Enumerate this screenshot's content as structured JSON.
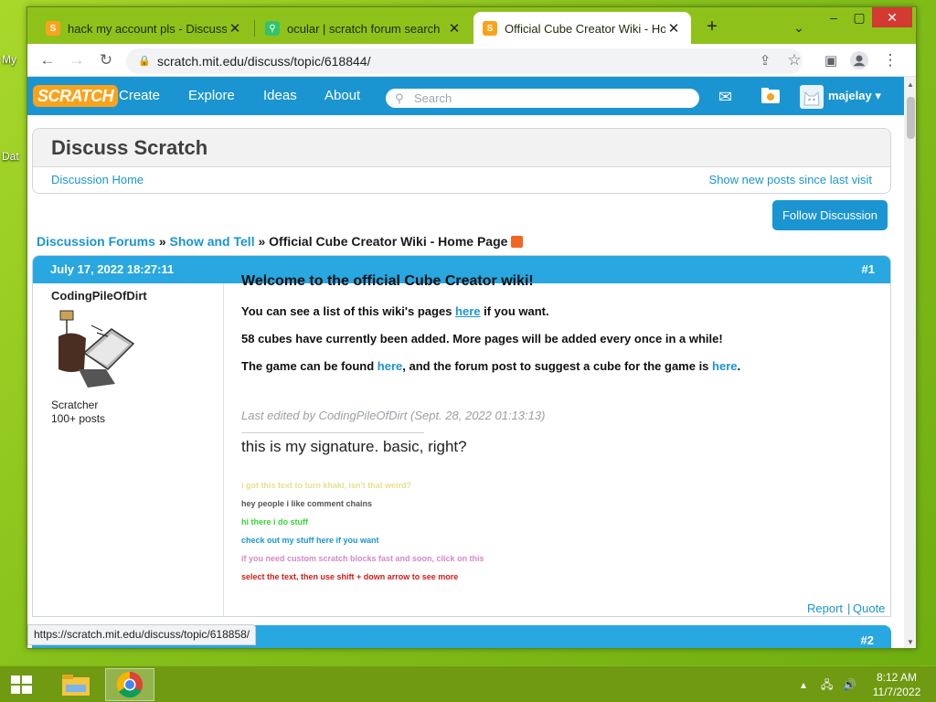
{
  "desktop": {
    "fragments": [
      "My",
      "Dat"
    ]
  },
  "browser": {
    "tabs": [
      {
        "title": "hack my account pls - Discuss Sc",
        "favicon": "scratch-favicon",
        "active": false
      },
      {
        "title": "ocular | scratch forum search",
        "favicon": "ocular-favicon",
        "active": false
      },
      {
        "title": "Official Cube Creator Wiki - Hom",
        "favicon": "scratch-favicon",
        "active": true
      }
    ],
    "new_tab": "+",
    "url": "scratch.mit.edu/discuss/topic/618844/",
    "status_url": "https://scratch.mit.edu/discuss/topic/618858/"
  },
  "scratch_nav": {
    "logo": "SCRATCH",
    "links": [
      "Create",
      "Explore",
      "Ideas",
      "About"
    ],
    "search_placeholder": "Search",
    "username": "majelay"
  },
  "discuss": {
    "title": "Discuss Scratch",
    "home_link": "Discussion Home",
    "new_posts_link": "Show new posts since last visit",
    "follow_button": "Follow Discussion",
    "breadcrumb": {
      "forums": "Discussion Forums",
      "sep": "»",
      "category": "Show and Tell",
      "topic": "Official Cube Creator Wiki - Home Page"
    }
  },
  "post1": {
    "date": "July 17, 2022 18:27:11",
    "number": "#1",
    "author": "CodingPileOfDirt",
    "rank": "Scratcher",
    "post_count": "100+ posts",
    "heading": "Welcome to the official Cube Creator wiki!",
    "line1_pre": "You can see a list of this wiki's pages ",
    "line1_link": "here",
    "line1_post": " if you want.",
    "line2": "58 cubes have currently been added. More pages will be added every once in a while!",
    "line3_pre": "The game can be found ",
    "line3_link1": "here",
    "line3_mid": ", and the forum post to suggest a cube for the game is ",
    "line3_link2": "here",
    "line3_post": ".",
    "edited": "Last edited by CodingPileOfDirt (Sept. 28, 2022 01:13:13)",
    "signature_main": "this is my signature. basic, right?",
    "signature_lines": [
      {
        "text": "i got this text to turn khaki, isn't that weird?",
        "color": "#e6e08e"
      },
      {
        "text": "hey people i like comment chains",
        "color": "#555555"
      },
      {
        "text": "hi there i do stuff",
        "color": "#3ad13a"
      },
      {
        "text": "check out my stuff here if you want",
        "color": "#1b95d1"
      },
      {
        "text": "if you need custom scratch blocks fast and soon, click on this",
        "color": "#d189c8"
      },
      {
        "text": "select the text, then use shift + down arrow to see more",
        "color": "#d11a1a"
      }
    ],
    "report": "Report",
    "separator": "|",
    "quote": "Quote"
  },
  "post2": {
    "number": "#2"
  },
  "taskbar": {
    "time": "8:12 AM",
    "date": "11/7/2022"
  },
  "colors": {
    "scratch_blue": "#1b95d1",
    "post_header": "#28a7e0",
    "desktop_green": "#8ec21a"
  }
}
